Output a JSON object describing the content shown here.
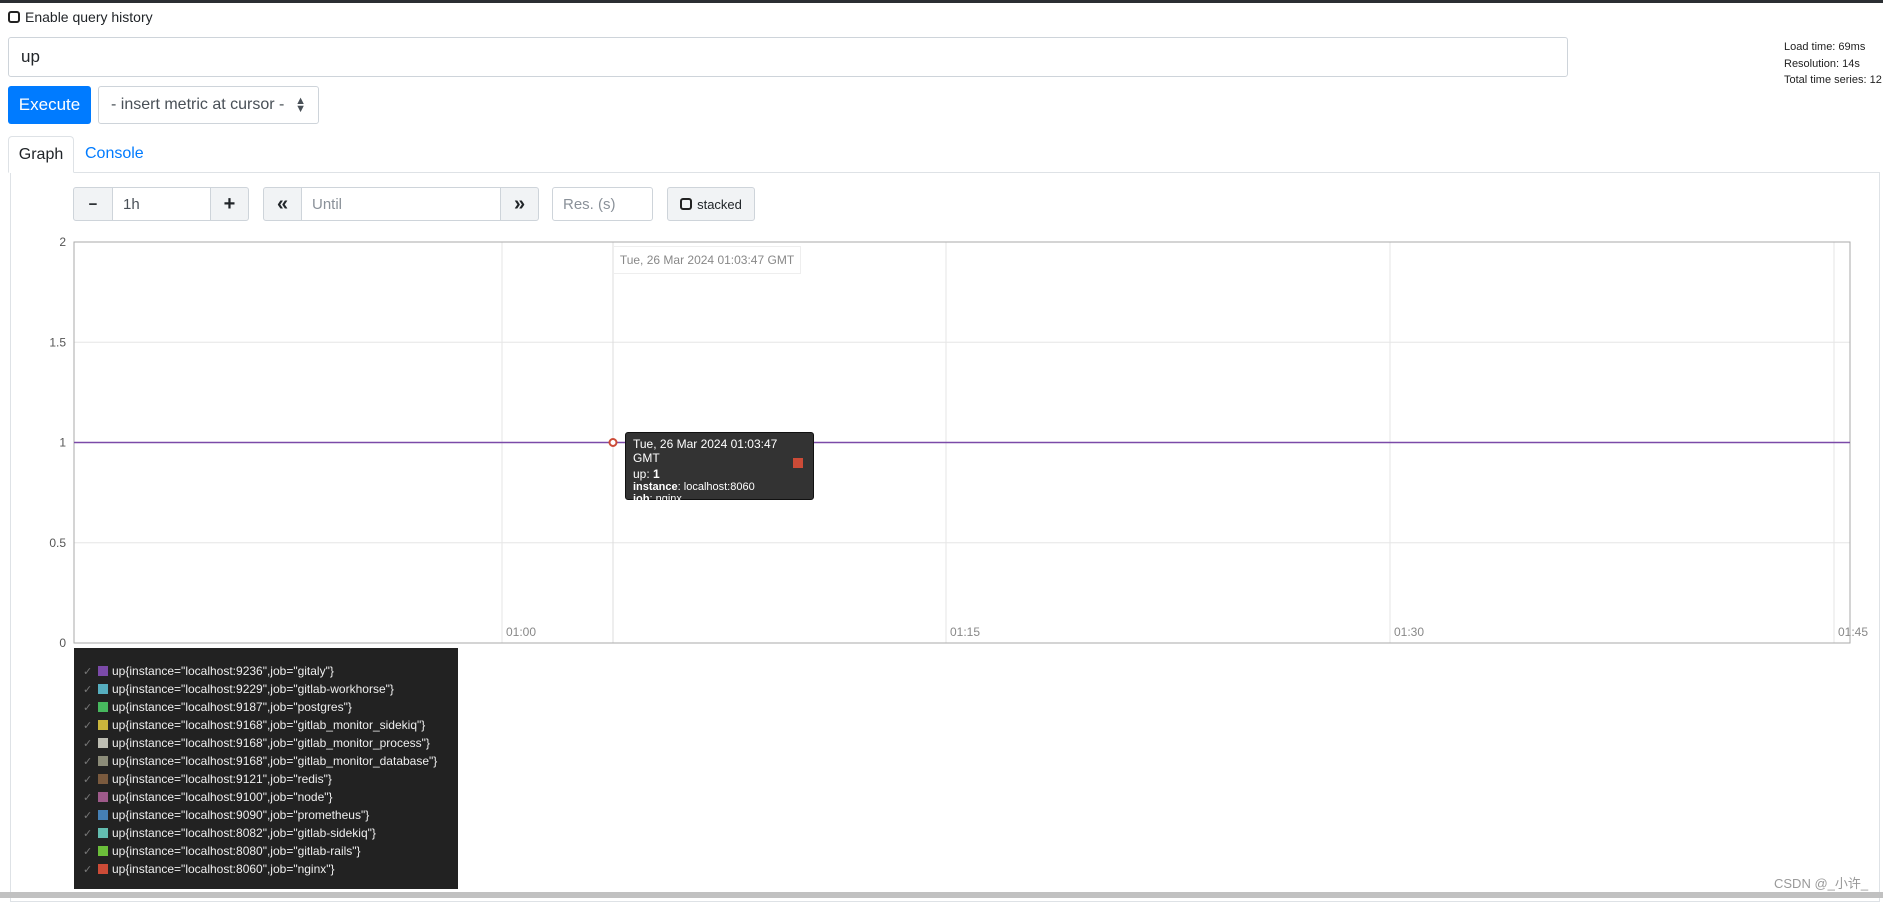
{
  "query_history": {
    "label": "Enable query history",
    "checked": false
  },
  "expression": {
    "value": "up"
  },
  "execute_label": "Execute",
  "metric_select": {
    "selected": "- insert metric at cursor -"
  },
  "stats": {
    "load_time": "Load time: 69ms",
    "resolution": "Resolution: 14s",
    "total_series": "Total time series: 12"
  },
  "tabs": [
    {
      "label": "Graph",
      "active": true
    },
    {
      "label": "Console",
      "active": false
    }
  ],
  "controls": {
    "minus": "−",
    "range": "1h",
    "plus": "+",
    "back": "«",
    "until_placeholder": "Until",
    "forward": "»",
    "res_placeholder": "Res. (s)",
    "stacked_label": "stacked",
    "stacked_checked": false
  },
  "chart_data": {
    "type": "line",
    "ylim": [
      0,
      2
    ],
    "yticks": [
      "0",
      "0.5",
      "1",
      "1.5",
      "2"
    ],
    "xticks": [
      "01:00",
      "01:15",
      "01:30",
      "01:45"
    ],
    "grid": true,
    "series_value": 1,
    "hover_time": "Tue, 26 Mar 2024 01:03:47 GMT"
  },
  "tooltip": {
    "time": "Tue, 26 Mar 2024 01:03:47 GMT",
    "metric": "up",
    "value": "1",
    "instance_label": "instance",
    "instance": "localhost:8060",
    "job_label": "job",
    "job": "nginx",
    "color": "#cc4b37"
  },
  "legend": [
    {
      "label": "up{instance=\"localhost:9236\",job=\"gitaly\"}",
      "color": "#7b4aa8"
    },
    {
      "label": "up{instance=\"localhost:9229\",job=\"gitlab-workhorse\"}",
      "color": "#56aebf"
    },
    {
      "label": "up{instance=\"localhost:9187\",job=\"postgres\"}",
      "color": "#47b85e"
    },
    {
      "label": "up{instance=\"localhost:9168\",job=\"gitlab_monitor_sidekiq\"}",
      "color": "#c9b53c"
    },
    {
      "label": "up{instance=\"localhost:9168\",job=\"gitlab_monitor_process\"}",
      "color": "#bdbdb2"
    },
    {
      "label": "up{instance=\"localhost:9168\",job=\"gitlab_monitor_database\"}",
      "color": "#8b8b78"
    },
    {
      "label": "up{instance=\"localhost:9121\",job=\"redis\"}",
      "color": "#7a5a3e"
    },
    {
      "label": "up{instance=\"localhost:9100\",job=\"node\"}",
      "color": "#9e5a8a"
    },
    {
      "label": "up{instance=\"localhost:9090\",job=\"prometheus\"}",
      "color": "#4580b5"
    },
    {
      "label": "up{instance=\"localhost:8082\",job=\"gitlab-sidekiq\"}",
      "color": "#63bdb0"
    },
    {
      "label": "up{instance=\"localhost:8080\",job=\"gitlab-rails\"}",
      "color": "#6bbe3a"
    },
    {
      "label": "up{instance=\"localhost:8060\",job=\"nginx\"}",
      "color": "#cc4b37"
    }
  ],
  "watermark": "CSDN @_小许_"
}
